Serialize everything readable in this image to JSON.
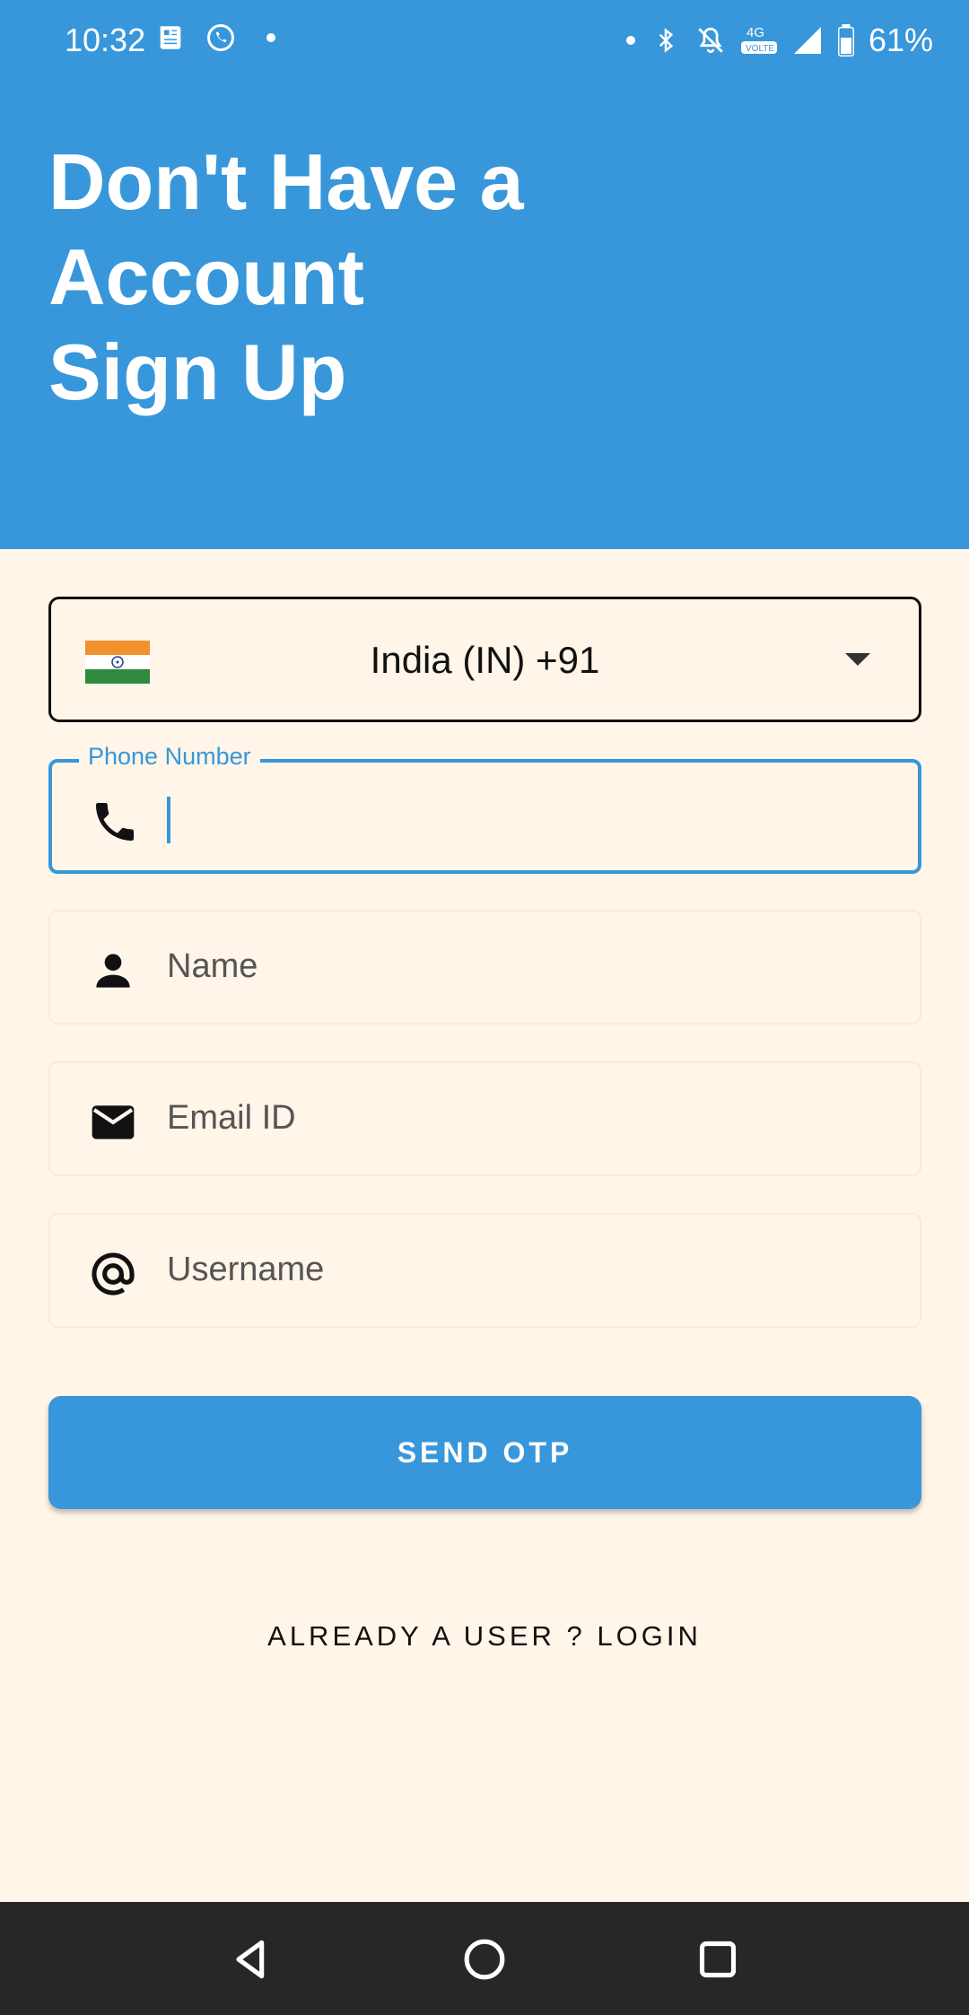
{
  "colors": {
    "accent": "#3797DA",
    "background": "#FFF5E8",
    "nav_bar": "#272727"
  },
  "status_bar": {
    "time": "10:32",
    "left_icons": [
      "news-icon",
      "whatsapp-icon",
      "dot-icon"
    ],
    "right_icons": [
      "dot-icon",
      "bluetooth-icon",
      "bell-off-icon",
      "volte-4g-icon",
      "signal-icon",
      "battery-icon"
    ],
    "battery": "61%"
  },
  "header": {
    "title_lines": [
      "Don't Have a",
      "Account",
      "Sign Up"
    ]
  },
  "form": {
    "country": {
      "flag": "india-flag-icon",
      "label": "India (IN)  +91"
    },
    "phone": {
      "label": "Phone Number",
      "value": ""
    },
    "name": {
      "placeholder": "Name"
    },
    "email": {
      "placeholder": "Email ID"
    },
    "username": {
      "placeholder": "Username"
    }
  },
  "actions": {
    "send_otp": "SEND OTP",
    "login": "ALREADY A USER ? LOGIN"
  },
  "nav_bar": {
    "buttons": [
      "back-icon",
      "home-icon",
      "recents-icon"
    ]
  }
}
